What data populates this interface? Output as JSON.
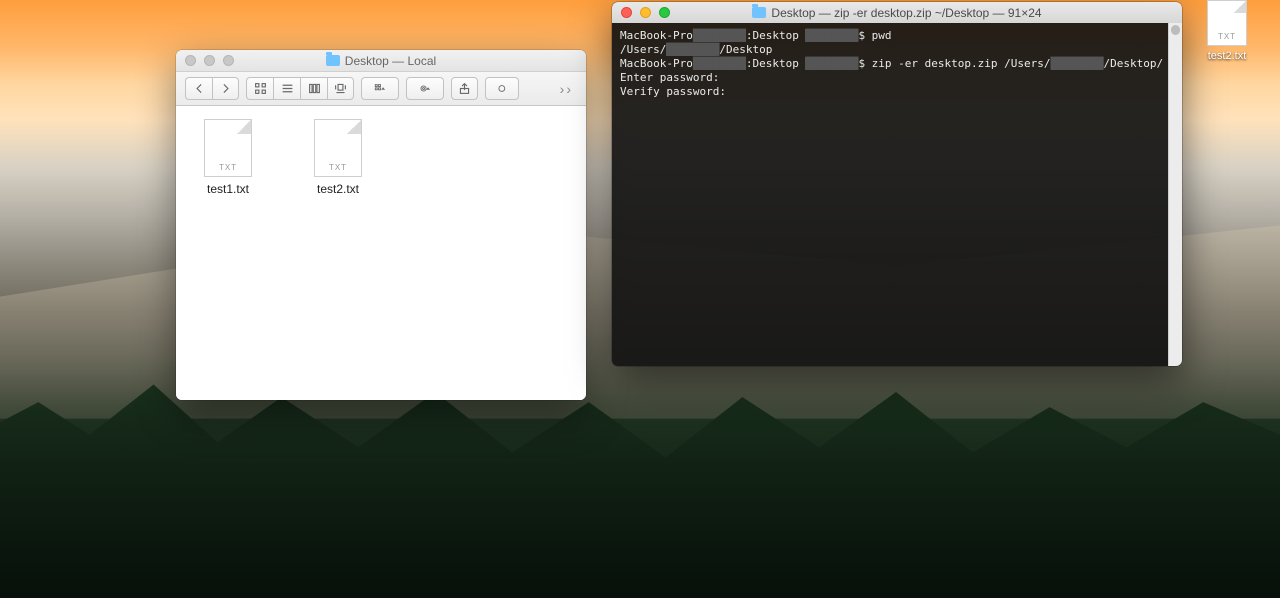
{
  "finder": {
    "title": "Desktop — Local",
    "traffic_inactive": true,
    "toolbar": {
      "back_icon": "chevron-left",
      "fwd_icon": "chevron-right",
      "view_icon": "icon-view",
      "view_list": "list-view",
      "view_col": "column-view",
      "view_cover": "cover-view",
      "arrange_icon": "arrange",
      "action_icon": "gear",
      "share_icon": "share",
      "tags_icon": "tags",
      "overflow": "››"
    },
    "files": [
      {
        "name": "test1.txt",
        "ext": "TXT"
      },
      {
        "name": "test2.txt",
        "ext": "TXT"
      }
    ]
  },
  "terminal": {
    "title": "Desktop — zip -er desktop.zip ~/Desktop — 91×24",
    "lines": {
      "l1a": "MacBook-Pro",
      "l1b": ":Desktop ",
      "l1c": "$ pwd",
      "l2a": "/Users/",
      "l2b": "/Desktop",
      "l3a": "MacBook-Pro",
      "l3b": ":Desktop ",
      "l3c": "$ zip -er desktop.zip /Users/",
      "l3d": "/Desktop/",
      "l4": "Enter password:",
      "l5": "Verify password:"
    },
    "redacted": "████████"
  },
  "desktop_file": {
    "name": "test2.txt",
    "ext": "TXT"
  }
}
